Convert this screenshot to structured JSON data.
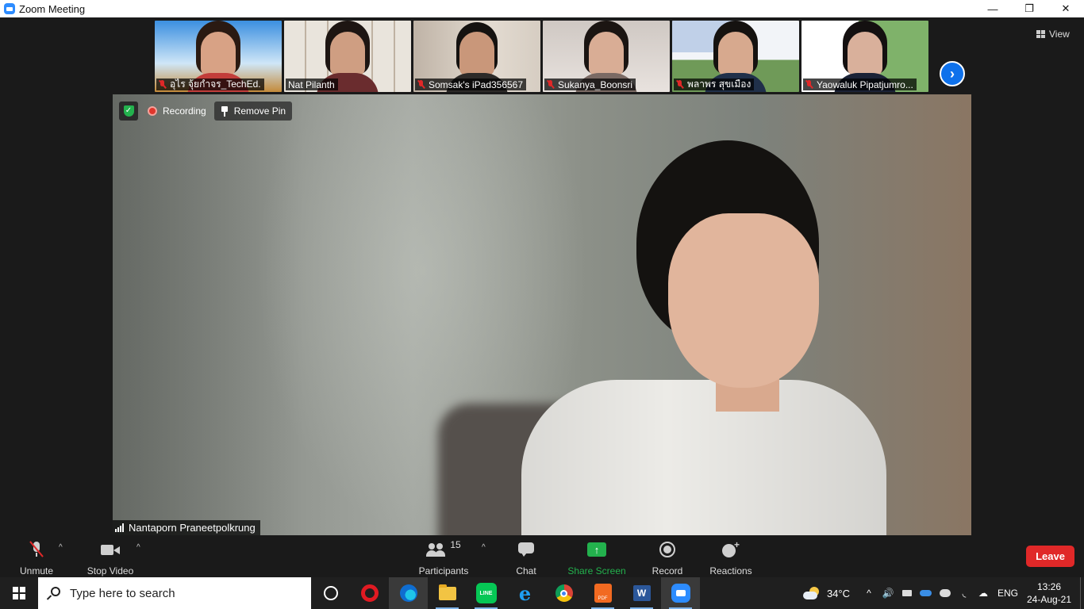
{
  "window": {
    "title": "Zoom Meeting",
    "controls": {
      "minimize": "—",
      "restore": "❐",
      "close": "✕"
    }
  },
  "view_button": {
    "label": "View",
    "icon": "grid-icon"
  },
  "thumbnails": [
    {
      "name": "อุไร จุ้ยกำจร_TechEd.",
      "muted": true,
      "bg": "sky",
      "colors": {
        "bg1": "#3b8fe0",
        "bg2": "#cfe6f7",
        "hair": "#2a1a12",
        "skin": "#d8a285",
        "shirt": "#c23d3a"
      }
    },
    {
      "name": "Nat Pilanth",
      "muted": false,
      "bg": "shelves",
      "colors": {
        "bg1": "#e9e4dc",
        "bg2": "#cbbfae",
        "hair": "#1d1512",
        "skin": "#cf9e82",
        "shirt": "#6a2c2e"
      }
    },
    {
      "name": "Somsak's iPad356567",
      "muted": true,
      "bg": "wall",
      "colors": {
        "bg1": "#bfb3a6",
        "bg2": "#e3dbd1",
        "hair": "#151210",
        "skin": "#c9977a",
        "shirt": "#2d2a28"
      }
    },
    {
      "name": "Sukanya_Boonsri",
      "muted": true,
      "bg": "wall",
      "colors": {
        "bg1": "#cfc8c3",
        "bg2": "#e8e2de",
        "hair": "#1b1512",
        "skin": "#d9ad95",
        "shirt": "#7b6a64"
      }
    },
    {
      "name": "พลาพร สุขเมือง",
      "muted": true,
      "bg": "slide",
      "colors": {
        "bg1": "#2d63b8",
        "bg2": "#f2f4f8",
        "hair": "#151210",
        "skin": "#d7a98e",
        "shirt": "#20304a"
      }
    },
    {
      "name": "Yaowaluk Pipatjumro...",
      "muted": true,
      "bg": "slide",
      "colors": {
        "bg1": "#ffffff",
        "bg2": "#7fb26a",
        "hair": "#141010",
        "skin": "#d9b09b",
        "shirt": "#1b2236"
      }
    }
  ],
  "next_page_icon": "chevron-right-icon",
  "main_video": {
    "participant_name": "Nantaporn Praneetpolkrung",
    "security_icon": "shield-check-icon",
    "recording_label": "Recording",
    "remove_pin_label": "Remove Pin"
  },
  "toolbar": {
    "unmute_label": "Unmute",
    "stop_video_label": "Stop Video",
    "participants_label": "Participants",
    "participants_count": "15",
    "chat_label": "Chat",
    "share_screen_label": "Share Screen",
    "record_label": "Record",
    "reactions_label": "Reactions",
    "leave_label": "Leave",
    "caret": "^"
  },
  "taskbar": {
    "search_placeholder": "Type here to search",
    "apps": [
      "cortana-icon",
      "opera-icon",
      "edge-icon",
      "file-explorer-icon",
      "line-icon",
      "internet-explorer-icon",
      "chrome-icon",
      "pdf-icon",
      "word-icon",
      "zoom-icon"
    ],
    "line_text": "LINE",
    "pdf_text": "PDF",
    "word_text": "W",
    "ie_text": "e",
    "weather_temp": "34°C",
    "language": "ENG",
    "time": "13:26",
    "date": "24-Aug-21",
    "chevron_up": "^",
    "speaker": "🔊",
    "wifi": "◟",
    "cloud_up": "☁"
  },
  "colors": {
    "accent_blue": "#0e71eb",
    "leave_red": "#e02828",
    "share_green": "#23b14d"
  }
}
